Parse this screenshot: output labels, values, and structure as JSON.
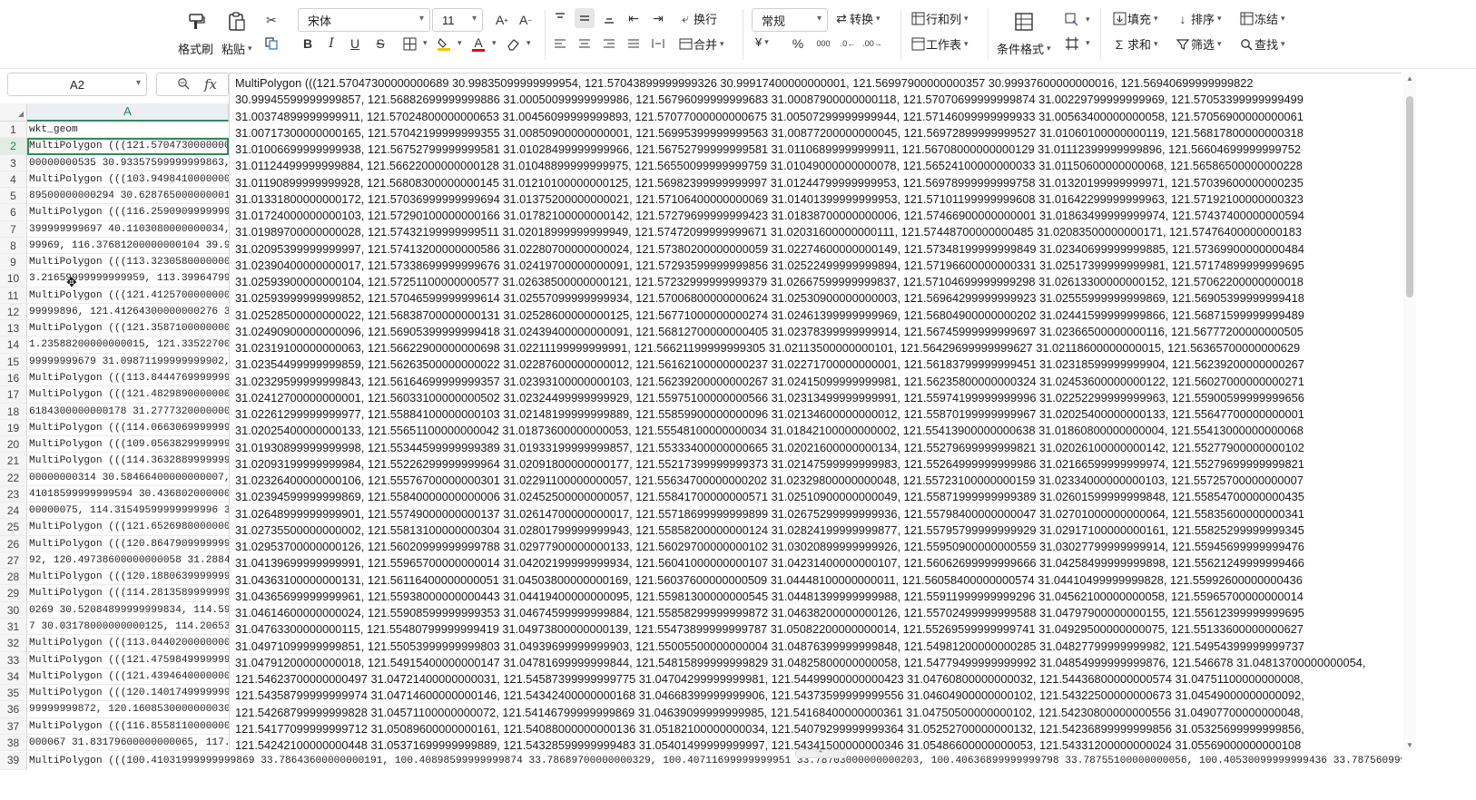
{
  "toolbar": {
    "format_painter": "格式刷",
    "paste": "粘贴",
    "font_name": "宋体",
    "font_size": "11",
    "wrap_text": "换行",
    "merge": "合并",
    "number_format": "常规",
    "convert": "转换",
    "rows_cols": "行和列",
    "worksheet": "工作表",
    "conditional_format": "条件格式",
    "fill": "填充",
    "sort": "排序",
    "freeze": "冻结",
    "sum": "求和",
    "filter": "筛选",
    "find": "查找",
    "currency_symbol": "¥",
    "percent_symbol": "%",
    "thousands_symbol": "000",
    "bold": "B",
    "italic": "I",
    "underline": "U",
    "strike": "S",
    "font_color_letter": "A"
  },
  "formula_bar": {
    "name_box": "A2",
    "fx_label": "fx",
    "content_lines": [
      "MultiPolygon (((121.57047300000000689 30.99835099999999954, 121.57043899999999326 30.99917400000000001, 121.56997900000000357 30.99937600000000016, 121.56940699999999822",
      "30.99945599999999857, 121.56882699999999886 31.00050099999999986, 121.56796099999999683 31.00087900000000118, 121.57070699999999874 31.00229799999999969, 121.57053399999999499",
      "31.00374899999999911, 121.57024800000000653 31.00456099999999893, 121.57077000000000675 31.00507299999999944, 121.57146099999999933 31.00563400000000058, 121.57056900000000061",
      "31.00717300000000165, 121.57042199999999355 31.00850900000000001, 121.56995399999999563 31.00877200000000045, 121.56972899999999527 31.01060100000000119, 121.56817800000000318",
      "31.01006699999999938, 121.56752799999999581 31.01028499999999966, 121.56752799999999581 31.01106899999999911, 121.56708000000000129 31.01112399999999896, 121.56604699999999752",
      "31.01124499999999884, 121.56622000000000128 31.01048899999999975, 121.56550099999999759 31.01049000000000078, 121.56524100000000033 31.01150600000000068, 121.56586500000000228",
      "31.01190899999999928, 121.56808300000000145 31.01210100000000125, 121.56982399999999997 31.01244799999999953, 121.56978999999999758 31.01320199999999971, 121.57039600000000235",
      "31.01331800000000172, 121.57036999999999694 31.01375200000000021, 121.57106400000000069 31.01401399999999953, 121.57101199999999608 31.01642299999999963, 121.57192100000000323",
      "31.01724000000000103, 121.57290100000000166 31.01782100000000142, 121.57279699999999423 31.01838700000000006, 121.57466900000000001 31.01863499999999974, 121.57437400000000594",
      "31.01989700000000028, 121.57432199999999511 31.02018999999999949, 121.57472099999999671 31.02031600000000111, 121.57448700000000485 31.02083500000000171, 121.57476400000000183",
      "31.02095399999999997, 121.57413200000000586 31.02280700000000024, 121.57380200000000059 31.02274600000000149, 121.57348199999999849 31.02340699999999885, 121.57369900000000484",
      "31.02390400000000017, 121.57338699999999676 31.02419700000000091, 121.57293599999999856 31.02522499999999894, 121.57196600000000331 31.02517399999999981, 121.57174899999999695",
      "31.02593900000000104, 121.57251100000000577 31.02638500000000121, 121.57232999999999379 31.02667599999999837, 121.57104699999999298 31.02613300000000152, 121.57062200000000018",
      "31.02593999999999852, 121.57046599999999614 31.02557099999999934, 121.57006800000000624 31.02530900000000003, 121.56964299999999923 31.02555999999999869, 121.56905399999999418",
      "31.02528500000000022, 121.56838700000000131 31.02528600000000125, 121.56771000000000274 31.02461399999999969, 121.56804900000000202 31.02441599999999866, 121.56871599999999489",
      "31.02490900000000096, 121.56905399999999418 31.02439400000000091, 121.56812700000000405 31.02378399999999914, 121.56745999999999697 31.02366500000000116, 121.56777200000000505",
      "31.02319100000000063, 121.56622900000000698 31.02211199999999991, 121.56621199999999305 31.02113500000000101, 121.56429699999999627 31.02118600000000015, 121.56365700000000629",
      "31.02354499999999859, 121.56263500000000022 31.02287600000000012, 121.56162100000000237 31.02271700000000001, 121.56183799999999451 31.02318599999999904, 121.56239200000000267",
      "31.02329599999999843, 121.56164699999999357 31.02393100000000103, 121.56239200000000267 31.02415099999999981, 121.56235800000000324 31.02453600000000122, 121.56027000000000271",
      "31.02412700000000001, 121.56033100000000502 31.02324499999999929, 121.55975100000000566 31.02313499999999991, 121.55974199999999996 31.02252299999999963, 121.55900599999999656",
      "31.02261299999999977, 121.55884100000000103 31.02148199999999889, 121.55859900000000096 31.02134600000000012, 121.55870199999999967 31.02025400000000133, 121.55647700000000001",
      "31.02025400000000133, 121.55651100000000042 31.01873600000000053, 121.55548100000000034 31.01842100000000002, 121.55413900000000638 31.01860800000000004, 121.55413000000000068",
      "31.01930899999999998, 121.55344599999999389 31.01933199999999857, 121.55333400000000665 31.02021600000000134, 121.55279699999999821 31.02026100000000142, 121.55277900000000102",
      "31.02093199999999984, 121.55226299999999964 31.02091800000000177, 121.55217399999999373 31.02147599999999983, 121.55264999999999986 31.02166599999999974, 121.55279699999999821",
      "31.02326400000000106, 121.55576700000000301 31.02291100000000057, 121.55634700000000202 31.02329800000000048, 121.55723100000000159 31.02334000000000103, 121.55725700000000007",
      "31.02394599999999869, 121.55840000000000006 31.02452500000000057, 121.55841700000000571 31.02510900000000049, 121.55871999999999389 31.02601599999999848, 121.55854700000000435",
      "31.02648999999999901, 121.55749000000000137 31.02614700000000017, 121.55718699999999899 31.02675299999999936, 121.55798400000000047 31.02701000000000064, 121.55835600000000341",
      "31.02735500000000002, 121.55813100000000304 31.02801799999999943, 121.55858200000000124 31.02824199999999877, 121.55795799999999929 31.02917100000000161, 121.55825299999999345",
      "31.02953700000000126, 121.56020999999999788 31.02977900000000133, 121.56029700000000102 31.03020899999999926, 121.55950900000000559 31.03027799999999914, 121.55945699999999476",
      "31.04139699999999991, 121.55965700000000014 31.04202199999999934, 121.56041000000000107 31.04231400000000107, 121.56062699999999666 31.04258499999999898, 121.55621249999999466",
      "31.04363100000000131, 121.56116400000000051 31.04503800000000169, 121.56037600000000509 31.04448100000000011, 121.56058400000000574 31.04410499999999828, 121.55992600000000436",
      "31.04365699999999961, 121.55938000000000443 31.04419400000000095, 121.55981300000000545 31.04481399999999988, 121.55911999999999296 31.04562100000000058, 121.55965700000000014",
      "31.04614600000000024, 121.55908599999999353 31.04674599999999884, 121.55858299999999872 31.04638200000000126, 121.55702499999999588 31.04797900000000155, 121.55612399999999695",
      "31.04763300000000115, 121.55480799999999419 31.04973800000000139, 121.55473899999999787 31.05082200000000014, 121.55269599999999741 31.04929500000000075, 121.55133600000000627",
      "31.04971099999999851, 121.55053999999999803 31.04939699999999903, 121.55005500000000004 31.04876399999999848, 121.54981200000000285 31.04827799999999982, 121.54954399999999737",
      "31.04791200000000018, 121.54915400000000147 31.04781699999999844, 121.54815899999999829 31.04825800000000058, 121.54779499999999992 31.04854999999999876, 121.546678 31.04813700000000054,",
      "121.54623700000000497 31.04721400000000031, 121.54587399999999775 31.04704299999999981, 121.54499900000000423 31.04760800000000032, 121.54436800000000574 31.04751100000000008,",
      "121.54358799999999974 31.04714600000000146, 121.54342400000000168 31.04668399999999906, 121.54373599999999556 31.04604900000000102, 121.54322500000000673 31.04549000000000092,",
      "121.54268799999999828 31.04571100000000072, 121.54146799999999869 31.04639099999999985, 121.54168400000000361 31.04750500000000102, 121.54230800000000556 31.04907700000000048,",
      "121.54177099999999712 31.05089600000000161, 121.54088000000000136 31.05182100000000034, 121.54079299999999364 31.05252700000000132, 121.54236899999999856 31.05325699999999856,",
      "121.54242100000000448 31.05371699999999889, 121.54328599999999483 31.05401499999999997, 121.54341500000000346 31.05486600000000053, 121.54331200000000024 31.05569000000000108"
    ]
  },
  "sheet": {
    "column_header": "A",
    "selected_row": 2,
    "rows": [
      {
        "n": "1",
        "text": "wkt_geom"
      },
      {
        "n": "2",
        "text": "MultiPolygon (((121.57047300000000689"
      },
      {
        "n": "3",
        "text": "00000000535 30.93357599999999863, 1"
      },
      {
        "n": "4",
        "text": "MultiPolygon (((103.94984100000000"
      },
      {
        "n": "5",
        "text": "89500000000294 30.62876500000000133"
      },
      {
        "n": "6",
        "text": "MultiPolygon (((116.25909099999999"
      },
      {
        "n": "7",
        "text": "399999999697 40.1103080000000034, 1"
      },
      {
        "n": "8",
        "text": "99969, 116.37681200000000104 39.9"
      },
      {
        "n": "9",
        "text": "MultiPolygon (((113.32305800000000"
      },
      {
        "n": "10",
        "text": "3.21659999999999959, 113.39964799999"
      },
      {
        "n": "11",
        "text": "MultiPolygon (((121.41257000000000"
      },
      {
        "n": "12",
        "text": "99999896, 121.41264300000000276 31"
      },
      {
        "n": "13",
        "text": "MultiPolygon (((121.35871000000000"
      },
      {
        "n": "14",
        "text": "1.23588200000000015, 121.3352270000"
      },
      {
        "n": "15",
        "text": "99999999679 31.09871199999999902, 1"
      },
      {
        "n": "16",
        "text": "MultiPolygon (((113.84447699999999"
      },
      {
        "n": "17",
        "text": "MultiPolygon (((121.48298900000000"
      },
      {
        "n": "18",
        "text": "6184300000000178 31.27773200000000"
      },
      {
        "n": "19",
        "text": "MultiPolygon (((114.06630699999999"
      },
      {
        "n": "20",
        "text": "MultiPolygon (((109.05638299999999"
      },
      {
        "n": "21",
        "text": "MultiPolygon (((114.36328899999999"
      },
      {
        "n": "22",
        "text": "00000000314 30.58466400000000007, 1"
      },
      {
        "n": "23",
        "text": "41018599999999594 30.43680200000000"
      },
      {
        "n": "24",
        "text": "00000075, 114.31549599999999996 30.5"
      },
      {
        "n": "25",
        "text": "MultiPolygon (((121.65269800000000"
      },
      {
        "n": "26",
        "text": "MultiPolygon (((120.86479099999999"
      },
      {
        "n": "27",
        "text": "92, 120.49738600000000058 31.28848"
      },
      {
        "n": "28",
        "text": "MultiPolygon (((120.18806399999999"
      },
      {
        "n": "29",
        "text": "MultiPolygon (((114.28135899999999"
      },
      {
        "n": "30",
        "text": "0269 30.52084899999999834, 114.590"
      },
      {
        "n": "31",
        "text": "7 30.03178000000000125, 114.206537"
      },
      {
        "n": "32",
        "text": "MultiPolygon (((113.04402000000000"
      },
      {
        "n": "33",
        "text": "MultiPolygon (((121.47598499999999"
      },
      {
        "n": "34",
        "text": "MultiPolygon (((121.43946400000000"
      },
      {
        "n": "35",
        "text": "MultiPolygon (((120.14017499999999"
      },
      {
        "n": "36",
        "text": "99999999872, 120.16085300000000302"
      },
      {
        "n": "37",
        "text": "MultiPolygon (((116.85581100000000"
      },
      {
        "n": "38",
        "text": "000067 31.83179600000000065, 117.2"
      }
    ],
    "bottom_row": {
      "n": "39",
      "text": "MultiPolygon (((100.41031999999999869 33.78643600000000191, 100.40898599999999874 33.78689700000000329, 100.40711699999999951 33.78703000000000203, 100.40636899999999798 33.78755100000000056, 100.40530099999999436 33.78756099999999"
    }
  }
}
